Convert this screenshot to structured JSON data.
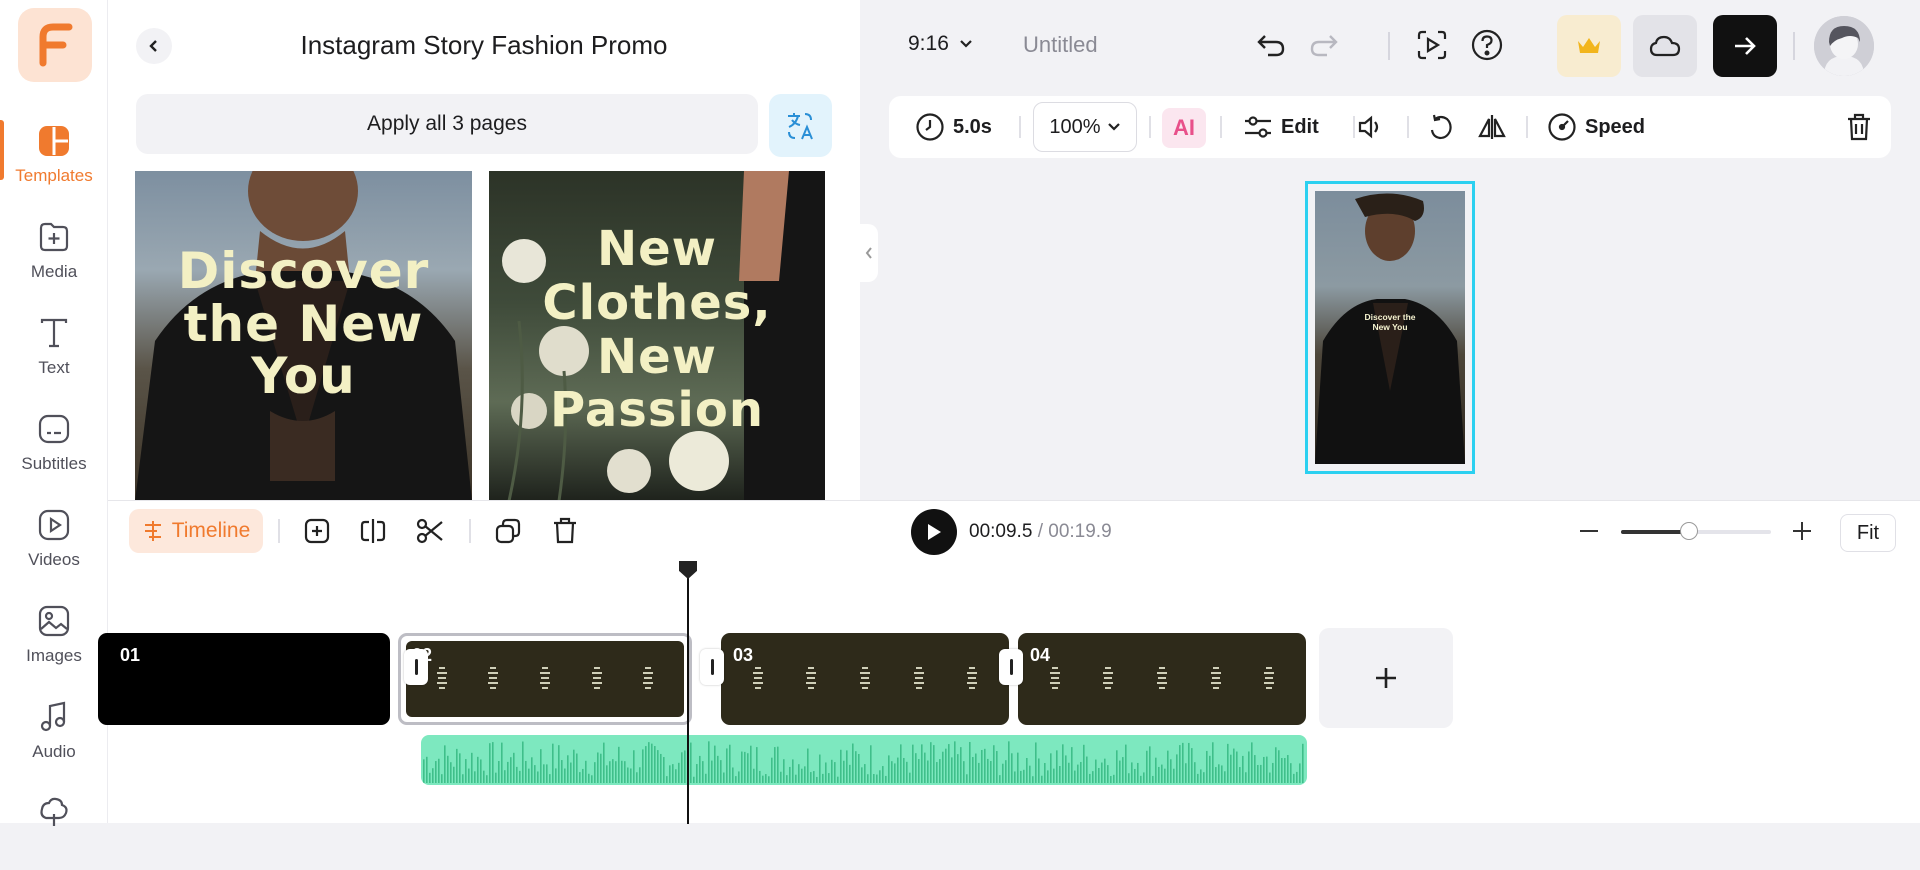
{
  "nav": {
    "items": [
      {
        "label": "Templates",
        "icon": "templates-icon"
      },
      {
        "label": "Media",
        "icon": "media-icon"
      },
      {
        "label": "Text",
        "icon": "text-icon"
      },
      {
        "label": "Subtitles",
        "icon": "subtitles-icon"
      },
      {
        "label": "Videos",
        "icon": "videos-icon"
      },
      {
        "label": "Images",
        "icon": "images-icon"
      },
      {
        "label": "Audio",
        "icon": "audio-icon"
      }
    ],
    "active": "Templates",
    "accent": "#f07a2e"
  },
  "panel": {
    "title": "Instagram Story Fashion Promo",
    "apply_label": "Apply all 3 pages",
    "thumbnails": [
      {
        "text": "Discover the New You"
      },
      {
        "text": "New Clothes, New Passion"
      }
    ]
  },
  "topbar": {
    "ratio": "9:16",
    "doc_name": "Untitled"
  },
  "toolbar": {
    "duration": "5.0s",
    "zoom": "100%",
    "ai_label": "AI",
    "edit_label": "Edit",
    "speed_label": "Speed"
  },
  "canvas": {
    "text": "Discover the New You"
  },
  "timeline": {
    "tab_label": "Timeline",
    "current_time": "00:09.5",
    "total_time": "00:19.9",
    "fit_label": "Fit",
    "zoom_level": 0.45,
    "clips": [
      {
        "number": "01"
      },
      {
        "number": "02"
      },
      {
        "number": "03"
      },
      {
        "number": "04"
      }
    ],
    "audio_color": "#7de8bf"
  }
}
